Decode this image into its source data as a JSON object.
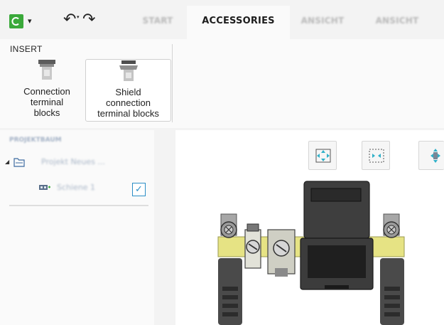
{
  "toolbar": {
    "app_icon": "green-square-logo-icon",
    "undo_icon": "undo-icon",
    "redo_icon": "redo-icon",
    "undo_symbol": "↶",
    "redo_symbol": "↷",
    "caret_symbol": "▾"
  },
  "tabs": [
    {
      "label": "START",
      "active": false
    },
    {
      "label": "ACCESSORIES",
      "active": true
    },
    {
      "label": "ANSICHT",
      "active": false
    },
    {
      "label": "ANSICHT",
      "active": false
    }
  ],
  "ribbon": {
    "group_title": "INSERT",
    "buttons": [
      {
        "label_lines": [
          "Connection",
          "terminal",
          "blocks"
        ],
        "icon": "connection-terminal-block-icon"
      },
      {
        "label_lines": [
          "Shield",
          "connection",
          "terminal blocks"
        ],
        "icon": "shield-connection-terminal-block-icon",
        "selected": true
      }
    ]
  },
  "project_tree": {
    "title": "PROJEKTBAUM",
    "project_label": "Projekt Neues ...",
    "rail_label": "Schiene 1",
    "rail_checked": true,
    "check_symbol": "✓",
    "expander_symbol": "◢"
  },
  "canvas": {
    "view_buttons": [
      "fit-view-icon",
      "zoom-extents-icon",
      "explode-icon"
    ]
  },
  "colors": {
    "accent_green": "#3aa93a",
    "check_blue": "#2b8ec6",
    "rail_yellow": "#e6e384",
    "tab_active_bg": "#fafafa"
  }
}
